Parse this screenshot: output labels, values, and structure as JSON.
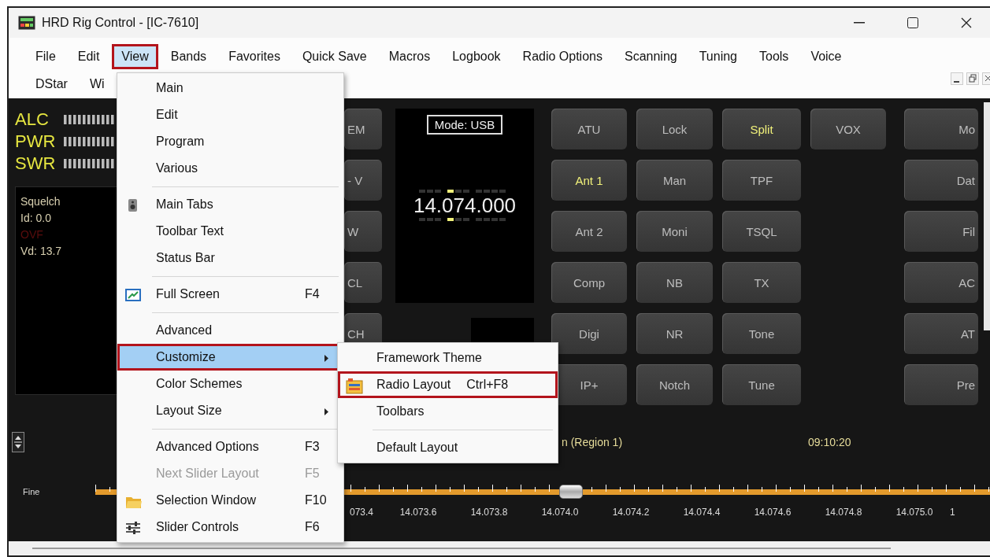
{
  "window": {
    "title": "HRD Rig Control - [IC-7610]"
  },
  "menu_bar": {
    "rows": [
      [
        {
          "label": "File",
          "selected": false,
          "outlined": false
        },
        {
          "label": "Edit",
          "selected": false,
          "outlined": false
        },
        {
          "label": "View",
          "selected": true,
          "outlined": true
        },
        {
          "label": "Bands",
          "selected": false,
          "outlined": false
        },
        {
          "label": "Favorites",
          "selected": false,
          "outlined": false
        },
        {
          "label": "Quick Save",
          "selected": false,
          "outlined": false
        },
        {
          "label": "Macros",
          "selected": false,
          "outlined": false
        },
        {
          "label": "Logbook",
          "selected": false,
          "outlined": false
        },
        {
          "label": "Radio Options",
          "selected": false,
          "outlined": false
        },
        {
          "label": "Scanning",
          "selected": false,
          "outlined": false
        },
        {
          "label": "Tuning",
          "selected": false,
          "outlined": false
        },
        {
          "label": "Tools",
          "selected": false,
          "outlined": false
        },
        {
          "label": "Voice",
          "selected": false,
          "outlined": false
        }
      ],
      [
        {
          "label": "DStar",
          "selected": false,
          "outlined": false
        },
        {
          "label": "Wi",
          "selected": false,
          "outlined": false
        }
      ]
    ]
  },
  "meters": [
    {
      "label": "ALC"
    },
    {
      "label": "PWR"
    },
    {
      "label": "SWR"
    }
  ],
  "status_panel": {
    "lines": [
      {
        "text": "Squelch",
        "kind": "normal"
      },
      {
        "text": "Id: 0.0",
        "kind": "normal"
      },
      {
        "text": "OVF",
        "kind": "alarm"
      },
      {
        "text": "Vd: 13.7",
        "kind": "normal"
      }
    ]
  },
  "side_buttons": [
    {
      "label": "EM",
      "active": false
    },
    {
      "label": "- V",
      "active": false
    },
    {
      "label": "W",
      "active": false
    },
    {
      "label": "CL",
      "active": false
    },
    {
      "label": "CH",
      "active": false
    }
  ],
  "display": {
    "mode": "Mode: USB",
    "frequency": "14.074.000"
  },
  "buttons": [
    [
      {
        "label": "ATU",
        "active": false
      },
      {
        "label": "Lock",
        "active": false
      },
      {
        "label": "Split",
        "active": true
      },
      {
        "label": "VOX",
        "active": false
      }
    ],
    [
      {
        "label": "Ant 1",
        "active": true
      },
      {
        "label": "Man",
        "active": false
      },
      {
        "label": "TPF",
        "active": false
      }
    ],
    [
      {
        "label": "Ant 2",
        "active": false
      },
      {
        "label": "Moni",
        "active": false
      },
      {
        "label": "TSQL",
        "active": false
      }
    ],
    [
      {
        "label": "Comp",
        "active": false
      },
      {
        "label": "NB",
        "active": false
      },
      {
        "label": "TX",
        "active": false
      }
    ],
    [
      {
        "label": "Digi",
        "active": false
      },
      {
        "label": "NR",
        "active": false
      },
      {
        "label": "Tone",
        "active": false
      }
    ],
    [
      {
        "label": "IP+",
        "active": false
      },
      {
        "label": "Notch",
        "active": false
      },
      {
        "label": "Tune",
        "active": false
      }
    ]
  ],
  "right_buttons": [
    {
      "label": "Mo",
      "active": false
    },
    {
      "label": "Dat",
      "active": false
    },
    {
      "label": "Fil",
      "active": false
    },
    {
      "label": "AC",
      "active": false
    },
    {
      "label": "AT",
      "active": false
    },
    {
      "label": "Pre",
      "active": false
    }
  ],
  "band_info": {
    "region": "n (Region 1)",
    "time": "09:10:20"
  },
  "tuning": {
    "label": "Fine",
    "level": 0.53,
    "ticks": [
      "073.4",
      "14.073.6",
      "14.073.8",
      "14.074.0",
      "14.074.2",
      "14.074.4",
      "14.074.6",
      "14.074.8",
      "14.075.0",
      "1"
    ]
  },
  "view_menu": {
    "items": [
      {
        "kind": "item",
        "label": "Main",
        "selected": false,
        "disabled": false,
        "outlined": false,
        "arrow": false
      },
      {
        "kind": "item",
        "label": "Edit",
        "selected": false,
        "disabled": false,
        "outlined": false,
        "arrow": false
      },
      {
        "kind": "item",
        "label": "Program",
        "selected": false,
        "disabled": false,
        "outlined": false,
        "arrow": false
      },
      {
        "kind": "item",
        "label": "Various",
        "selected": false,
        "disabled": false,
        "outlined": false,
        "arrow": false
      },
      {
        "kind": "separator"
      },
      {
        "kind": "item",
        "label": "Main Tabs",
        "selected": false,
        "disabled": false,
        "outlined": false,
        "arrow": false
      },
      {
        "kind": "item",
        "label": "Toolbar Text",
        "selected": false,
        "disabled": false,
        "outlined": false,
        "arrow": false
      },
      {
        "kind": "item",
        "label": "Status Bar",
        "selected": false,
        "disabled": false,
        "outlined": false,
        "arrow": false
      },
      {
        "kind": "separator"
      },
      {
        "kind": "item",
        "label": "Full Screen",
        "shortcut": "F4",
        "selected": false,
        "disabled": false,
        "outlined": false,
        "arrow": false
      },
      {
        "kind": "separator"
      },
      {
        "kind": "item",
        "label": "Advanced",
        "selected": false,
        "disabled": false,
        "outlined": false,
        "arrow": false
      },
      {
        "kind": "item",
        "label": "Customize",
        "selected": true,
        "disabled": false,
        "outlined": true,
        "arrow": true
      },
      {
        "kind": "item",
        "label": "Color Schemes",
        "selected": false,
        "disabled": false,
        "outlined": false,
        "arrow": false
      },
      {
        "kind": "item",
        "label": "Layout Size",
        "selected": false,
        "disabled": false,
        "outlined": false,
        "arrow": true
      },
      {
        "kind": "separator"
      },
      {
        "kind": "item",
        "label": "Advanced Options",
        "shortcut": "F3",
        "selected": false,
        "disabled": false,
        "outlined": false,
        "arrow": false
      },
      {
        "kind": "item",
        "label": "Next Slider Layout",
        "shortcut": "F5",
        "selected": false,
        "disabled": true,
        "outlined": false,
        "arrow": false
      },
      {
        "kind": "item",
        "label": "Selection Window",
        "shortcut": "F10",
        "selected": false,
        "disabled": false,
        "outlined": false,
        "arrow": false
      },
      {
        "kind": "item",
        "label": "Slider Controls",
        "shortcut": "F6",
        "selected": false,
        "disabled": false,
        "outlined": false,
        "arrow": false
      }
    ]
  },
  "customize_menu": {
    "items": [
      {
        "kind": "item",
        "label": "Framework Theme",
        "selected": false,
        "disabled": false,
        "outlined": false,
        "arrow": false
      },
      {
        "kind": "item",
        "label": "Radio Layout",
        "shortcut": "Ctrl+F8",
        "selected": false,
        "disabled": false,
        "outlined": true,
        "arrow": false
      },
      {
        "kind": "item",
        "label": "Toolbars",
        "selected": false,
        "disabled": false,
        "outlined": false,
        "arrow": false
      },
      {
        "kind": "separator"
      },
      {
        "kind": "item",
        "label": "Default Layout",
        "selected": false,
        "disabled": false,
        "outlined": false,
        "arrow": false
      }
    ]
  }
}
